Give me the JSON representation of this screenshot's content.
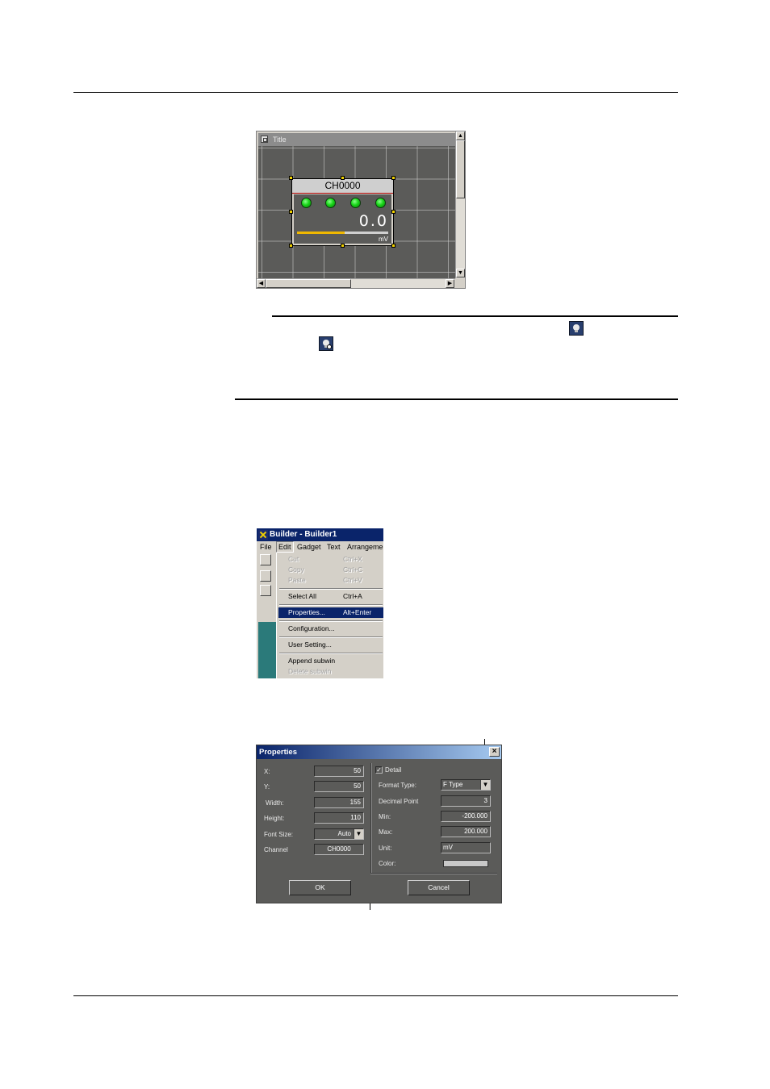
{
  "figure1": {
    "window_title": "Title",
    "gadget": {
      "title": "CH0000",
      "value": "0.0",
      "unit": "mV",
      "bar_fraction": 0.52,
      "lamp_count": 4
    }
  },
  "figure2": {
    "app_title": "Builder - Builder1",
    "menubar": [
      "File",
      "Edit",
      "Gadget",
      "Text",
      "Arrangemen"
    ],
    "menu_items": [
      {
        "label": "Cut",
        "shortcut": "Ctrl+X",
        "state": "disabled"
      },
      {
        "label": "Copy",
        "shortcut": "Ctrl+C",
        "state": "disabled"
      },
      {
        "label": "Paste",
        "shortcut": "Ctrl+V",
        "state": "disabled"
      },
      {
        "label": "Select All",
        "shortcut": "Ctrl+A",
        "state": "normal"
      },
      {
        "label": "Properties...",
        "shortcut": "Alt+Enter",
        "state": "highlighted"
      },
      {
        "label": "Configuration...",
        "shortcut": "",
        "state": "normal"
      },
      {
        "label": "User Setting...",
        "shortcut": "",
        "state": "normal"
      },
      {
        "label": "Append subwin",
        "shortcut": "",
        "state": "normal"
      },
      {
        "label": "Delete subwin",
        "shortcut": "",
        "state": "disabled"
      }
    ]
  },
  "figure3": {
    "title": "Properties",
    "left_fields": [
      {
        "label": "X:",
        "value": "50"
      },
      {
        "label": "Y:",
        "value": "50"
      },
      {
        "label": "Width:",
        "value": "155"
      },
      {
        "label": "Height:",
        "value": "110"
      },
      {
        "label": "Font Size:",
        "value": "Auto"
      },
      {
        "label": "Channel",
        "value": "CH0000"
      }
    ],
    "detail_label": "Detail",
    "detail_checked": true,
    "right_fields": [
      {
        "label": "Format Type:",
        "value": "F Type"
      },
      {
        "label": "Decimal Point",
        "value": "3"
      },
      {
        "label": "Min:",
        "value": "-200.000"
      },
      {
        "label": "Max:",
        "value": "200.000"
      },
      {
        "label": "Unit:",
        "value": "mV"
      },
      {
        "label": "Color:",
        "value": ""
      }
    ],
    "ok_label": "OK",
    "cancel_label": "Cancel"
  },
  "colors": {
    "canvas": "#5b5b59",
    "lamp": "#19d619",
    "bar": "#f0b800",
    "menu_highlight": "#0a246a"
  },
  "icons": [
    "monitor-toolbar-icon",
    "monitor-stop-toolbar-icon"
  ]
}
